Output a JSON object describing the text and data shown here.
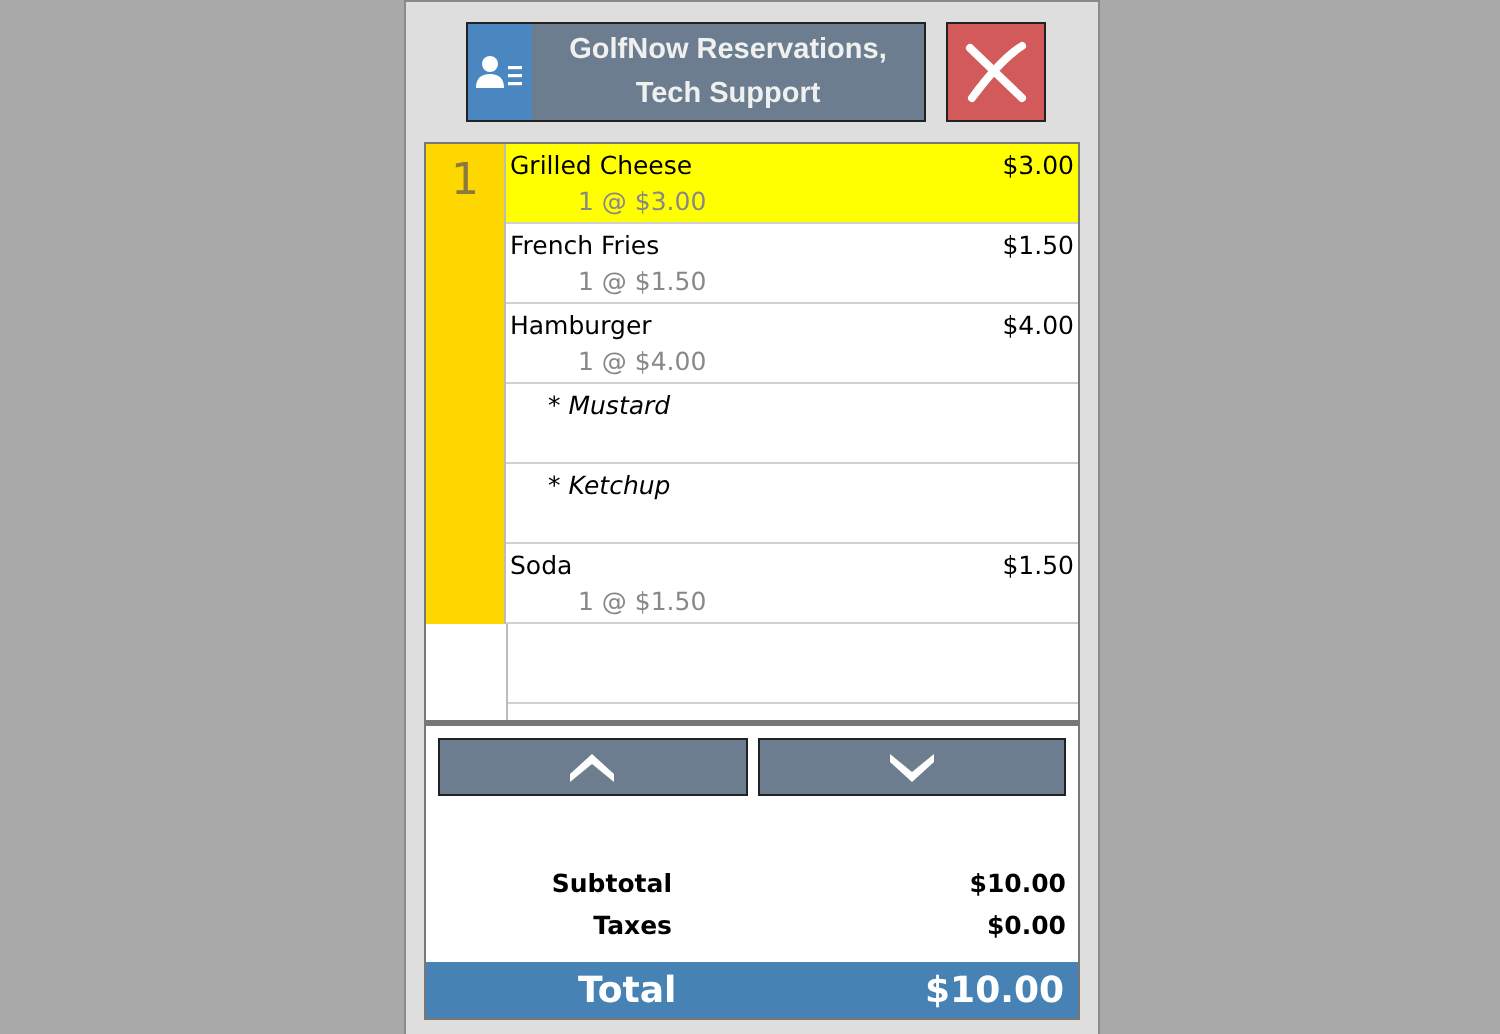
{
  "header": {
    "title": "GolfNow Reservations,\nTech Support"
  },
  "order": {
    "seats": [
      {
        "label": "1",
        "items": [
          {
            "kind": "item",
            "name": "Grilled Cheese",
            "price": "$3.00",
            "detail": "1 @ $3.00",
            "selected": true
          },
          {
            "kind": "item",
            "name": "French Fries",
            "price": "$1.50",
            "detail": "1 @ $1.50",
            "selected": false
          },
          {
            "kind": "item",
            "name": "Hamburger",
            "price": "$4.00",
            "detail": "1 @ $4.00",
            "selected": false
          },
          {
            "kind": "modifier",
            "name": "* Mustard",
            "selected": false
          },
          {
            "kind": "modifier",
            "name": "* Ketchup",
            "selected": false
          },
          {
            "kind": "item",
            "name": "Soda",
            "price": "$1.50",
            "detail": "1 @ $1.50",
            "selected": false
          }
        ]
      }
    ]
  },
  "totals": [
    {
      "label": "Subtotal",
      "value": "$10.00"
    },
    {
      "label": "Taxes",
      "value": "$0.00"
    }
  ],
  "total": {
    "label": "Total",
    "value": "$10.00"
  }
}
